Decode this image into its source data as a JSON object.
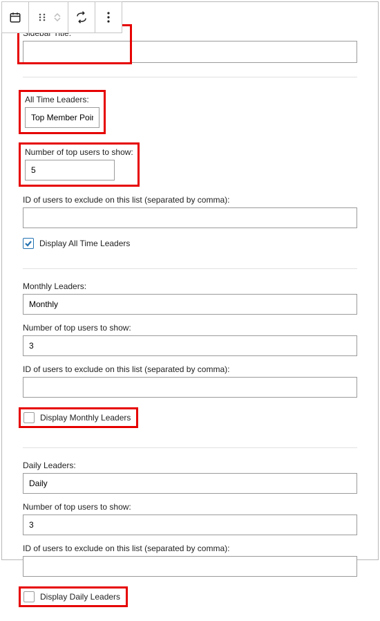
{
  "toolbar": {
    "main_icon": "calendar-icon",
    "drag_icon": "drag-icon",
    "move_icon": "arrows-icon",
    "replace_icon": "replace-icon",
    "more_icon": "more-icon"
  },
  "sidebar_title": {
    "label": "Sidebar Title:",
    "value": ""
  },
  "all_time": {
    "heading_label": "All Time Leaders:",
    "heading_value": "Top Member Points",
    "count_label": "Number of top users to show:",
    "count_value": "5",
    "exclude_label": "ID of users to exclude on this list (separated by comma):",
    "exclude_value": "",
    "display_label": "Display All Time Leaders",
    "display_checked": true
  },
  "monthly": {
    "heading_label": "Monthly Leaders:",
    "heading_value": "Monthly",
    "count_label": "Number of top users to show:",
    "count_value": "3",
    "exclude_label": "ID of users to exclude on this list (separated by comma):",
    "exclude_value": "",
    "display_label": "Display Monthly Leaders",
    "display_checked": false
  },
  "daily": {
    "heading_label": "Daily Leaders:",
    "heading_value": "Daily",
    "count_label": "Number of top users to show:",
    "count_value": "3",
    "exclude_label": "ID of users to exclude on this list (separated by comma):",
    "exclude_value": "",
    "display_label": "Display Daily Leaders",
    "display_checked": false
  },
  "highlights": {
    "sidebar_title": true,
    "all_time_heading": true,
    "all_time_count": true,
    "monthly_display": true,
    "daily_display": true
  }
}
